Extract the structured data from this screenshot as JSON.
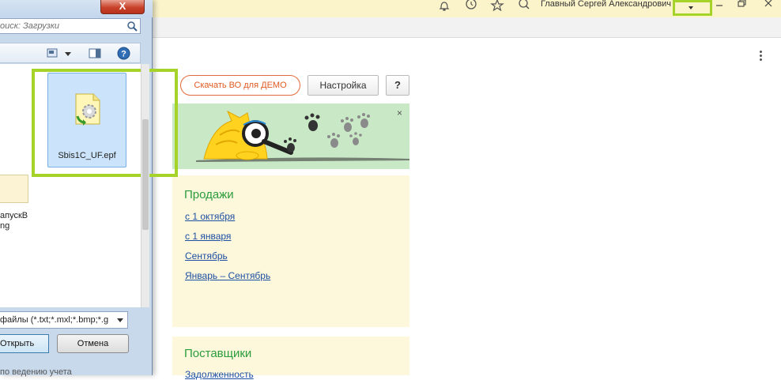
{
  "header": {
    "user_name": "Главный Сергей Александрович",
    "icons": [
      "bell-icon",
      "history-icon",
      "star-icon",
      "search-icon"
    ]
  },
  "actions": {
    "demo_button": "Скачать ВО для ДЕМО",
    "settings_button": "Настройка",
    "help_button": "?"
  },
  "banner": {
    "close_label": "×"
  },
  "sales": {
    "title": "Продажи",
    "links": [
      "с 1 октября",
      "с 1 января",
      "Сентябрь",
      "Январь – Сентябрь"
    ]
  },
  "suppliers": {
    "title": "Поставщики",
    "links": [
      "Задолженность"
    ]
  },
  "dialog": {
    "close_label": "X",
    "search_placeholder": "оиск: Загрузки",
    "left_file_label": "апускВ\nng",
    "selected_file": "Sbis1C_UF.epf",
    "file_type_filter": "файлы (*.txt;*.mxl;*.bmp;*.g",
    "open_button": "Открыть",
    "cancel_button": "Отмена",
    "bottom_text": "по ведению учета"
  },
  "colors": {
    "highlight": "#a6d32a",
    "header_bg": "#fbf3c9",
    "panel_bg": "#fdf7dc",
    "accent_green": "#2a9d3c",
    "link": "#1d4fa3",
    "demo_orange": "#e05a22"
  }
}
